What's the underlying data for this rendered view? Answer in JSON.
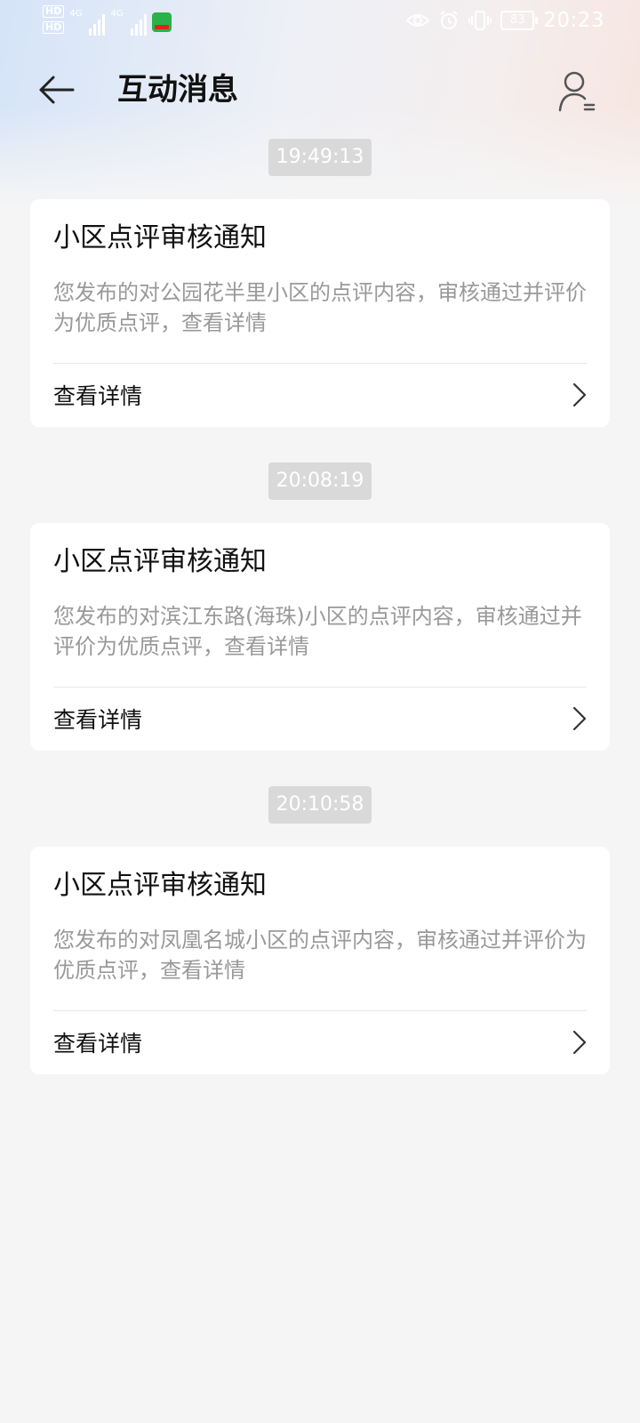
{
  "status_bar": {
    "hd_1": "HD",
    "hd_2": "HD",
    "net_1": "4G",
    "net_2": "4G",
    "battery": "83",
    "time": "20:23"
  },
  "header": {
    "title": "互动消息"
  },
  "messages": [
    {
      "time": "19:49:13",
      "title": "小区点评审核通知",
      "body": "您发布的对公园花半里小区的点评内容，审核通过并评价为优质点评，查看详情",
      "link": "查看详情"
    },
    {
      "time": "20:08:19",
      "title": "小区点评审核通知",
      "body": "您发布的对滨江东路(海珠)小区的点评内容，审核通过并评价为优质点评，查看详情",
      "link": "查看详情"
    },
    {
      "time": "20:10:58",
      "title": "小区点评审核通知",
      "body": "您发布的对凤凰名城小区的点评内容，审核通过并评价为优质点评，查看详情",
      "link": "查看详情"
    }
  ],
  "icons": {
    "back": "arrow-left-icon",
    "profile": "user-settings-icon",
    "chevron": "chevron-right-icon"
  }
}
